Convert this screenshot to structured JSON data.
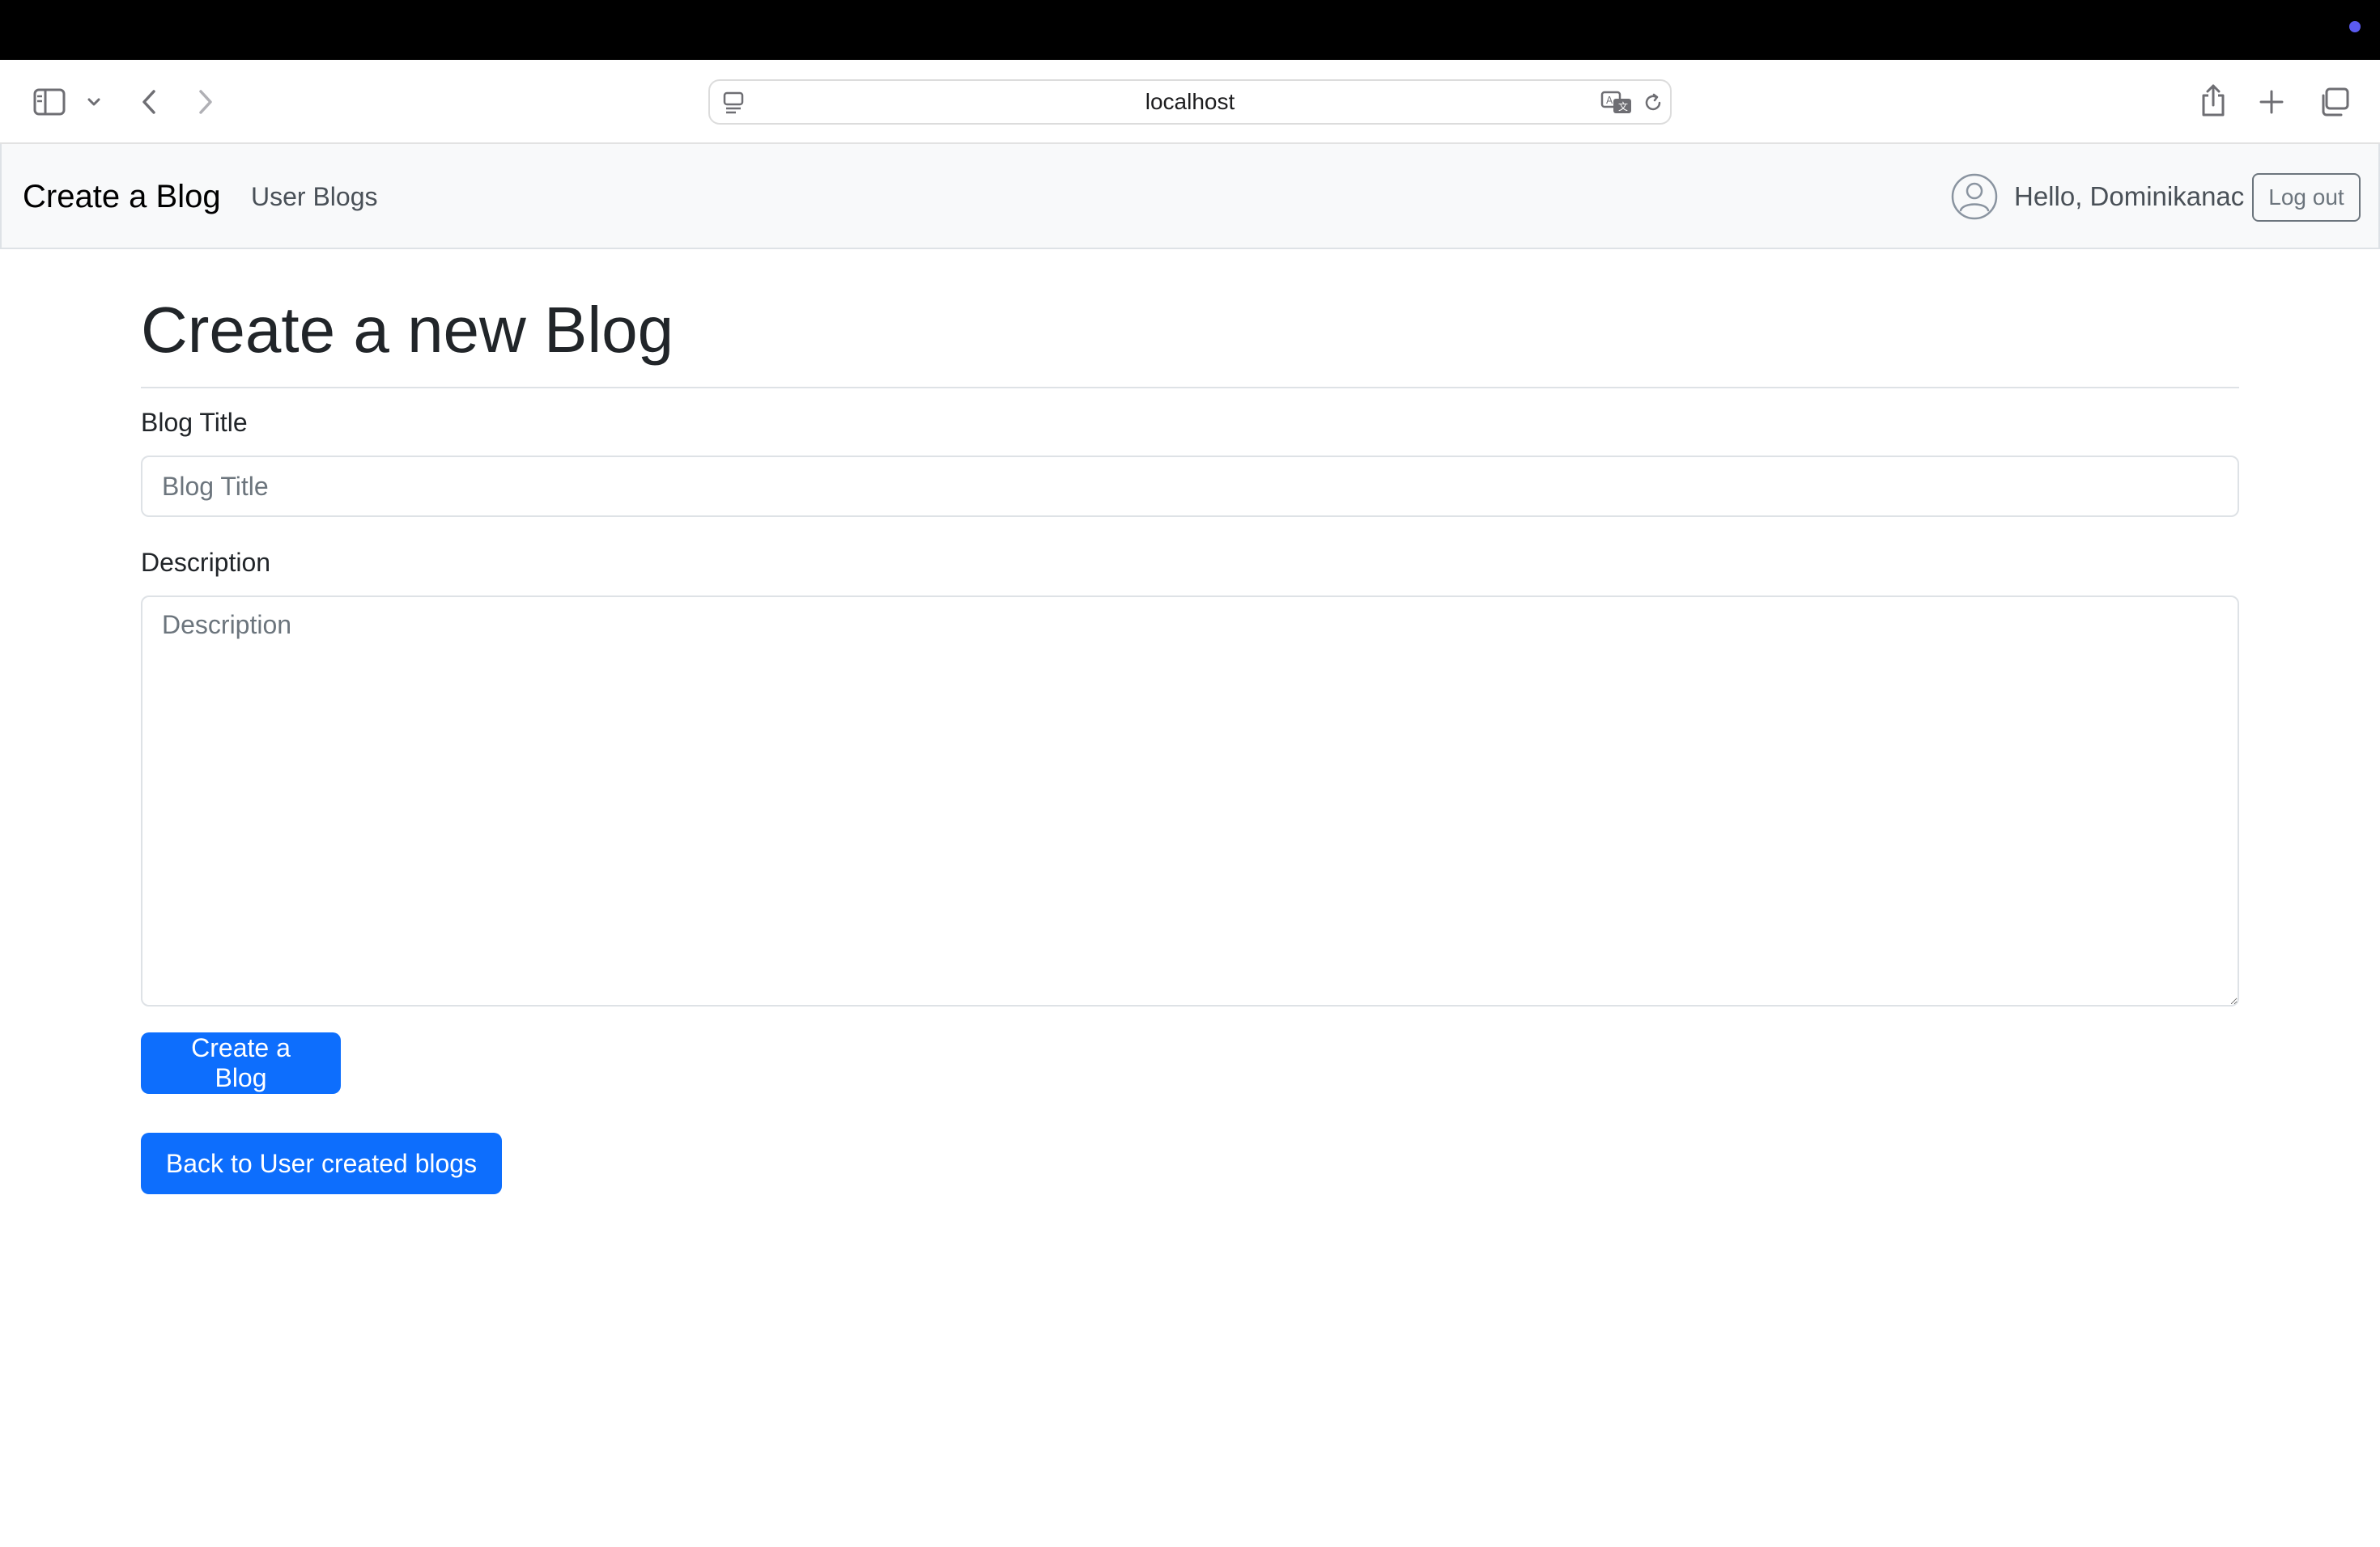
{
  "browser": {
    "address": "localhost",
    "icons": {
      "sidebar": "sidebar-icon",
      "chevron": "chevron-down-icon",
      "back": "back-arrow-icon",
      "forward": "forward-arrow-icon",
      "page": "page-menu-icon",
      "translate": "translate-icon",
      "reload": "reload-icon",
      "share": "share-icon",
      "new_tab": "plus-icon",
      "tabs": "tab-overview-icon"
    }
  },
  "navbar": {
    "brand": "Create a Blog",
    "links": [
      "User Blogs"
    ],
    "greeting": "Hello, Dominikanac",
    "logout_label": "Log out"
  },
  "form": {
    "heading": "Create a new Blog",
    "title_label": "Blog Title",
    "title_placeholder": "Blog Title",
    "title_value": "",
    "description_label": "Description",
    "description_placeholder": "Description",
    "description_value": "",
    "submit_label": "Create a Blog",
    "back_label": "Back to User created blogs"
  },
  "colors": {
    "primary": "#0d6efd",
    "navbar_bg": "#f8f9fa",
    "top_strip": "#000000",
    "accent_dot": "#5b5bf0"
  }
}
